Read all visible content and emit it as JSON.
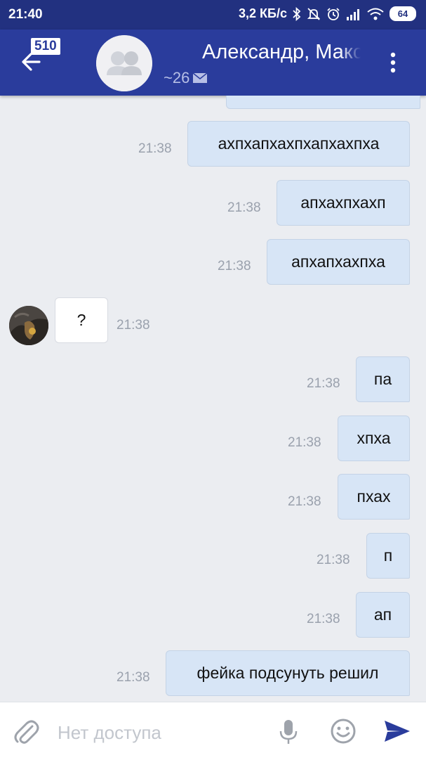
{
  "status_bar": {
    "time": "21:40",
    "net_speed": "3,2 КБ/с",
    "battery": "64"
  },
  "header": {
    "unread_count": "510",
    "title": "Александр, Максим",
    "subtitle": "~26"
  },
  "messages": [
    {
      "text": "ахпхапхахпхапхахпха",
      "time": "21:38",
      "dir": "out"
    },
    {
      "text": "апхахпхахп",
      "time": "21:38",
      "dir": "out"
    },
    {
      "text": "апхапхахпха",
      "time": "21:38",
      "dir": "out"
    },
    {
      "text": "?",
      "time": "21:38",
      "dir": "in"
    },
    {
      "text": "па",
      "time": "21:38",
      "dir": "out"
    },
    {
      "text": "хпха",
      "time": "21:38",
      "dir": "out"
    },
    {
      "text": "пхах",
      "time": "21:38",
      "dir": "out"
    },
    {
      "text": "п",
      "time": "21:38",
      "dir": "out"
    },
    {
      "text": "ап",
      "time": "21:38",
      "dir": "out"
    },
    {
      "text": "фейка подсунуть решил",
      "time": "21:38",
      "dir": "out"
    }
  ],
  "composer": {
    "placeholder": "Нет доступа"
  },
  "colors": {
    "status_bar": "#223180",
    "app_bar": "#2a3c9c",
    "background": "#ebedf1",
    "outgoing_bubble": "#d7e5f6",
    "incoming_bubble": "#ffffff",
    "send_accent": "#2a3c9c"
  },
  "icons": [
    "bluetooth-icon",
    "mute-icon",
    "alarm-icon",
    "signal-icon",
    "wifi-icon",
    "battery-icon",
    "back-arrow-icon",
    "group-avatar-icon",
    "envelope-icon",
    "more-vert-icon",
    "attach-icon",
    "mic-icon",
    "emoji-icon",
    "send-icon"
  ]
}
